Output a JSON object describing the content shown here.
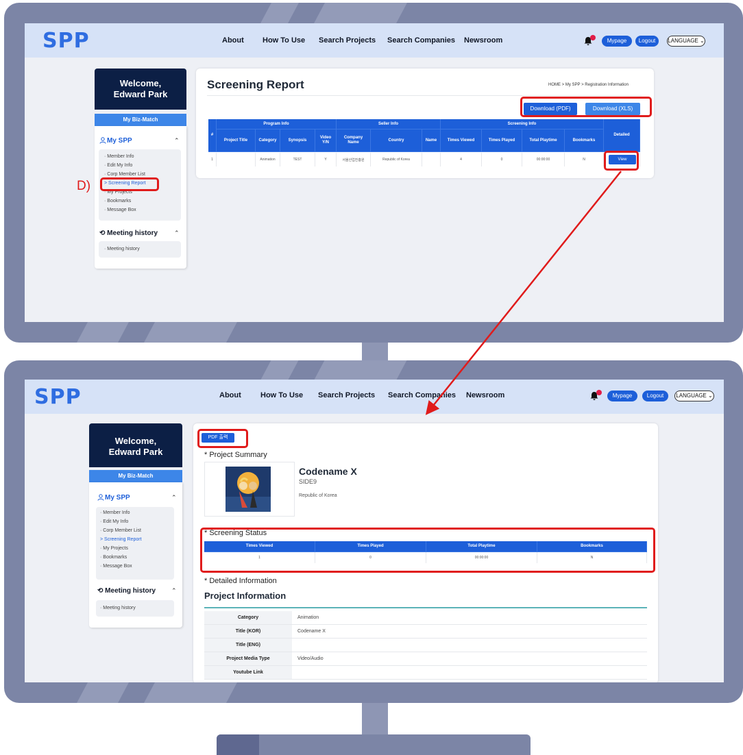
{
  "header": {
    "logo": "SPP",
    "nav": [
      "About",
      "How To Use",
      "Search Projects",
      "Search Companies",
      "Newsroom"
    ],
    "notification_count": "0",
    "mypage": "Mypage",
    "logout": "Logout",
    "language": "LANGUAGE"
  },
  "sidebar": {
    "welcome": "Welcome, Edward Park",
    "biz_match": "My Biz-Match",
    "my_spp": "My SPP",
    "items": [
      "· Member Info",
      "· Edit My Info",
      "· Corp Member List",
      "> Screening Report",
      "· My Projects",
      "· Bookmarks",
      "· Message Box"
    ],
    "meeting_title": "Meeting history",
    "meeting_items": [
      "· Meeting history"
    ]
  },
  "annotation": {
    "marker": "D)"
  },
  "report": {
    "title": "Screening Report",
    "breadcrumb": "HOME > My SPP > Registration Information",
    "download_pdf": "Download (PDF)",
    "download_xls": "Download (XLS)",
    "groups": [
      "#",
      "Program Info",
      "Seller Info",
      "Screening Info",
      "Detailed"
    ],
    "columns": [
      "Project Title",
      "Category",
      "Synopsis",
      "Video Y/N",
      "Company Name",
      "Country",
      "Name",
      "Times Viewed",
      "Times Played",
      "Total Playtime",
      "Bookmarks"
    ],
    "row": [
      "1",
      "",
      "Animation",
      "TEST",
      "Y",
      "서울산업진흥원",
      "Republic of Korea",
      "",
      "4",
      "0",
      "00:00:00",
      "N"
    ],
    "view_button": "View"
  },
  "detail": {
    "pdf_button": "PDF 출력",
    "project_summary": "* Project Summary",
    "project_name": "Codename X",
    "company": "SIDE9",
    "country": "Republic of Korea",
    "screening_status": "* Screening Status",
    "status_headers": [
      "Times Viewed",
      "Times Played",
      "Total Playtime",
      "Bookmarks"
    ],
    "status_values": [
      "1",
      "0",
      "00:00:00",
      "N"
    ],
    "detailed_information": "* Detailed Information",
    "project_information": "Project Information",
    "info_rows": [
      {
        "label": "Category",
        "value": "Animation"
      },
      {
        "label": "Title (KOR)",
        "value": "Codename X"
      },
      {
        "label": "Title (ENG)",
        "value": ""
      },
      {
        "label": "Project Media Type",
        "value": "Video/Audio"
      },
      {
        "label": "Youtube Link",
        "value": ""
      }
    ]
  },
  "colors": {
    "bezel": "#7c85a6",
    "header": "#d6e2f7",
    "primary": "#1d5fd9",
    "navy": "#0c1f45",
    "highlight": "#e01b1b"
  }
}
